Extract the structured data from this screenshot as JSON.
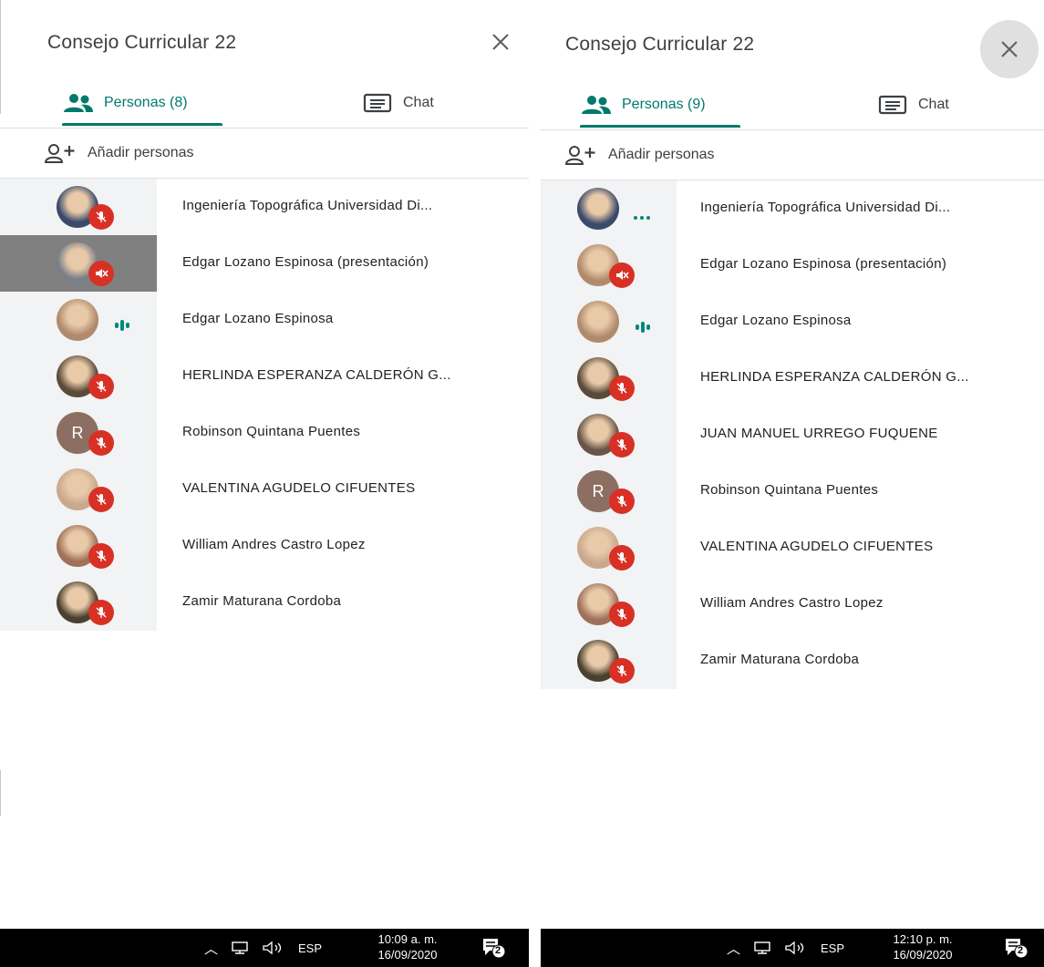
{
  "left": {
    "title": "Consejo Curricular 22",
    "tabs": [
      {
        "label": "Personas (8)"
      },
      {
        "label": "Chat"
      }
    ],
    "add_people": "Añadir personas",
    "people": [
      {
        "name": "Ingeniería Topográfica Universidad Di...",
        "avatar_color": "#3a4a6a",
        "avatar_letter": "",
        "state": "muted"
      },
      {
        "name": "Edgar Lozano Espinosa (presentación)",
        "avatar_color": "#7a8088",
        "avatar_letter": "",
        "state": "presenting-muted",
        "selected": true
      },
      {
        "name": "Edgar Lozano Espinosa",
        "avatar_color": "#b08a6c",
        "avatar_letter": "",
        "state": "talking"
      },
      {
        "name": "HERLINDA ESPERANZA CALDERÓN G...",
        "avatar_color": "#5a4a3a",
        "avatar_letter": "",
        "state": "muted"
      },
      {
        "name": "Robinson Quintana Puentes",
        "avatar_color": "#8d6e63",
        "avatar_letter": "R",
        "state": "muted"
      },
      {
        "name": "VALENTINA AGUDELO CIFUENTES",
        "avatar_color": "#c9a88e",
        "avatar_letter": "",
        "state": "muted"
      },
      {
        "name": "William Andres Castro Lopez",
        "avatar_color": "#a0705a",
        "avatar_letter": "",
        "state": "muted"
      },
      {
        "name": "Zamir Maturana Cordoba",
        "avatar_color": "#4a4030",
        "avatar_letter": "",
        "state": "muted"
      }
    ],
    "taskbar": {
      "lang": "ESP",
      "time": "10:09 a. m.",
      "date": "16/09/2020",
      "notifications": "2"
    }
  },
  "right": {
    "title": "Consejo Curricular 22",
    "tabs": [
      {
        "label": "Personas (9)"
      },
      {
        "label": "Chat"
      }
    ],
    "add_people": "Añadir personas",
    "people": [
      {
        "name": "Ingeniería Topográfica Universidad Di...",
        "avatar_color": "#3a4a6a",
        "avatar_letter": "",
        "state": "connecting"
      },
      {
        "name": "Edgar Lozano Espinosa (presentación)",
        "avatar_color": "#b08a6c",
        "avatar_letter": "",
        "state": "presenting-muted"
      },
      {
        "name": "Edgar Lozano Espinosa",
        "avatar_color": "#b08a6c",
        "avatar_letter": "",
        "state": "talking"
      },
      {
        "name": "HERLINDA ESPERANZA CALDERÓN G...",
        "avatar_color": "#5a4a3a",
        "avatar_letter": "",
        "state": "muted"
      },
      {
        "name": "JUAN MANUEL URREGO FUQUENE",
        "avatar_color": "#6a5448",
        "avatar_letter": "",
        "state": "muted"
      },
      {
        "name": "Robinson Quintana Puentes",
        "avatar_color": "#8d6e63",
        "avatar_letter": "R",
        "state": "muted"
      },
      {
        "name": "VALENTINA AGUDELO CIFUENTES",
        "avatar_color": "#c9a88e",
        "avatar_letter": "",
        "state": "muted"
      },
      {
        "name": "William Andres Castro Lopez",
        "avatar_color": "#a0705a",
        "avatar_letter": "",
        "state": "muted"
      },
      {
        "name": "Zamir Maturana Cordoba",
        "avatar_color": "#4a4030",
        "avatar_letter": "",
        "state": "muted"
      }
    ],
    "taskbar": {
      "lang": "ESP",
      "time": "12:10 p. m.",
      "date": "16/09/2020",
      "notifications": "2"
    }
  },
  "colors": {
    "accent": "#00796b",
    "mute": "#d93025",
    "talk": "#00897b"
  }
}
